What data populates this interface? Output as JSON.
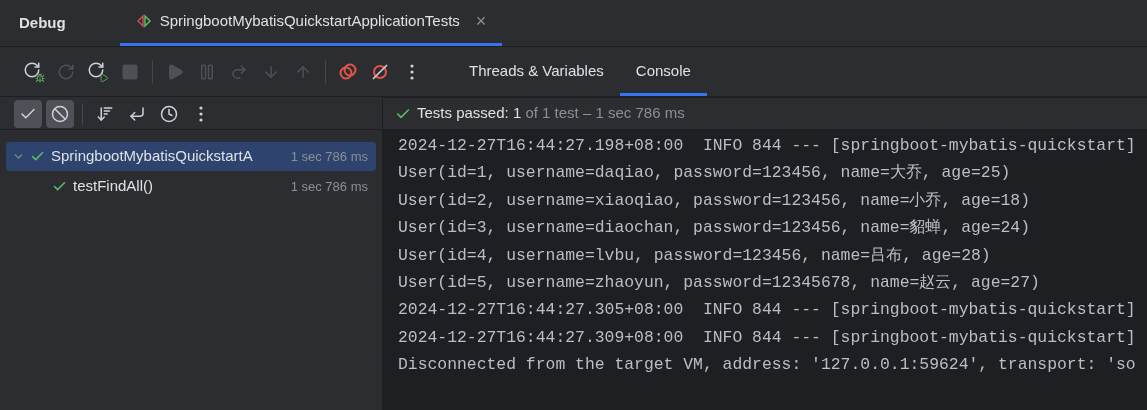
{
  "header": {
    "title": "Debug",
    "session_tab": {
      "label": "SpringbootMybatisQuickstartApplicationTests",
      "selected": true,
      "close": "×"
    }
  },
  "toolbar": [
    {
      "kind": "rerun-debug",
      "disabled": false
    },
    {
      "kind": "rerun",
      "disabled": true
    },
    {
      "kind": "rerun-failed",
      "disabled": false
    },
    {
      "kind": "stop",
      "disabled": true
    },
    {
      "kind": "sep"
    },
    {
      "kind": "resume",
      "disabled": true
    },
    {
      "kind": "pause",
      "disabled": true
    },
    {
      "kind": "step-over",
      "disabled": true
    },
    {
      "kind": "step-into",
      "disabled": true
    },
    {
      "kind": "step-out",
      "disabled": true
    },
    {
      "kind": "sep"
    },
    {
      "kind": "breakpoints",
      "disabled": false
    },
    {
      "kind": "mute",
      "disabled": false
    },
    {
      "kind": "more",
      "disabled": false
    }
  ],
  "view_tabs": [
    {
      "label": "Threads & Variables",
      "selected": false
    },
    {
      "label": "Console",
      "selected": true
    }
  ],
  "test_toolbar": [
    {
      "kind": "show-passed",
      "selected": true
    },
    {
      "kind": "show-ignored",
      "selected": true
    },
    {
      "kind": "sep"
    },
    {
      "kind": "sort"
    },
    {
      "kind": "collapse"
    },
    {
      "kind": "duration"
    },
    {
      "kind": "more"
    }
  ],
  "status": {
    "passed_label": "Tests passed: ",
    "passed_count": "1",
    "rest": "of 1 test – 1 sec 786 ms"
  },
  "tree": [
    {
      "name": "SpringbootMybatisQuickstartA",
      "time": "1 sec 786 ms",
      "selected": true,
      "expanded": true,
      "children": [
        {
          "name": "testFindAll()",
          "time": "1 sec 786 ms",
          "selected": false
        }
      ]
    }
  ],
  "console": [
    "2024-12-27T16:44:27.198+08:00  INFO 844 --- [springboot-mybatis-quickstart]",
    "User(id=1, username=daqiao, password=123456, name=大乔, age=25)",
    "User(id=2, username=xiaoqiao, password=123456, name=小乔, age=18)",
    "User(id=3, username=diaochan, password=123456, name=貂蝉, age=24)",
    "User(id=4, username=lvbu, password=123456, name=吕布, age=28)",
    "User(id=5, username=zhaoyun, password=12345678, name=赵云, age=27)",
    "2024-12-27T16:44:27.305+08:00  INFO 844 --- [springboot-mybatis-quickstart]",
    "2024-12-27T16:44:27.309+08:00  INFO 844 --- [springboot-mybatis-quickstart]",
    "Disconnected from the target VM, address: '127.0.0.1:59624', transport: 'so"
  ]
}
